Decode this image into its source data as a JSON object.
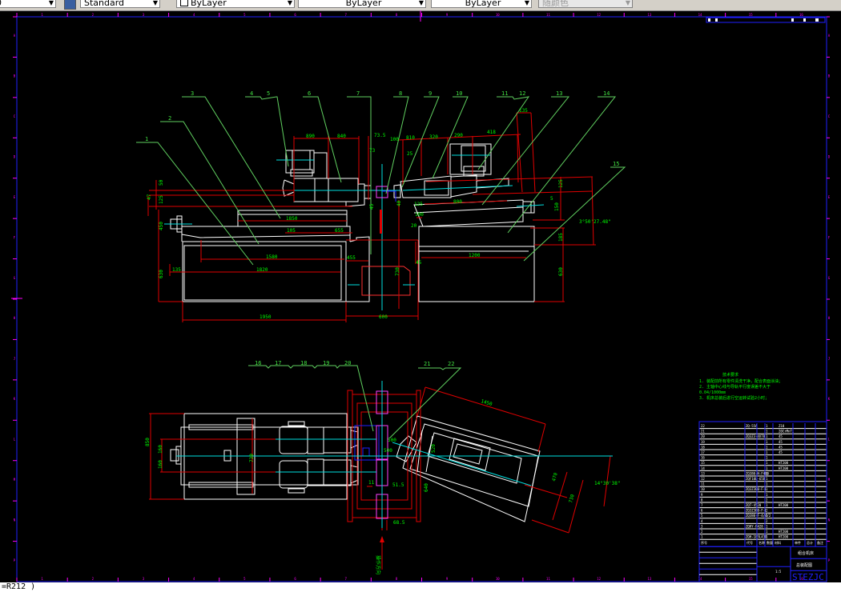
{
  "toolbar": {
    "layer_value": "0",
    "text_style": "Standard",
    "color": "ByLayer",
    "linetype": "ByLayer",
    "lineweight": "ByLayer",
    "plot_style": "随颜色"
  },
  "command_line": "=R212 )",
  "colors": {
    "background": "#000000",
    "frame": "#0000ff",
    "geometry": "#ffffff",
    "dimension": "#ff0000",
    "dim_text": "#00ff00",
    "centerline": "#00ffff",
    "leader": "#80ff80",
    "grid_ref": "#ff00ff"
  },
  "grid_refs": {
    "columns": [
      "1",
      "2",
      "3",
      "4",
      "5",
      "6",
      "7",
      "8",
      "9",
      "10",
      "11",
      "12",
      "13",
      "14",
      "15",
      "16"
    ],
    "rows": [
      "A",
      "B",
      "C",
      "D",
      "E",
      "F",
      "G",
      "H",
      "J",
      "K",
      "L",
      "M",
      "N",
      "P"
    ]
  },
  "balloons": [
    "1",
    "2",
    "3",
    "4",
    "5",
    "6",
    "7",
    "8",
    "9",
    "10",
    "11",
    "12",
    "13",
    "14",
    "15",
    "16",
    "17",
    "18",
    "19",
    "20",
    "21",
    "22"
  ],
  "dims": {
    "front": [
      "890",
      "840",
      "73.5",
      "73",
      "100",
      "810",
      "320",
      "290",
      "418",
      "135",
      "1850",
      "105",
      "655",
      "1580",
      "1820",
      "1950",
      "135",
      "50",
      "47",
      "125",
      "450",
      "630",
      "455",
      "45",
      "25",
      "800",
      "125",
      "100",
      "20",
      "5",
      "125",
      "3°50'27.48\"",
      "185",
      "1200",
      "630",
      "45",
      "600",
      "730",
      "150",
      "40"
    ],
    "plan": [
      "1450",
      "850",
      "160",
      "160",
      "730",
      "14°30'38\"",
      "470",
      "730",
      "500",
      "520",
      "640",
      "51.5",
      "68.5",
      "11",
      "500"
    ]
  },
  "notes": {
    "title": "技术要求",
    "lines": [
      "1. 装配前所有零件清洗干净，配合表面涂油；",
      "2. 主轴中心线与导轨平行度误差不大于",
      "   0.04/1000mm",
      "3. 机床总装后进行空运转试验2小时；"
    ]
  },
  "title_block": {
    "rows": [
      [
        "22",
        "ZQ-55A",
        "1",
        "",
        "Z18"
      ],
      [
        "21",
        "",
        "1",
        "",
        "20CrMnTi"
      ],
      [
        "20",
        "ZQ3Z3-4X78",
        "1",
        "",
        "45"
      ],
      [
        "19",
        "",
        "1",
        "",
        "45"
      ],
      [
        "18",
        "",
        "1",
        "",
        "45"
      ],
      [
        "17",
        "",
        "1",
        "",
        "45"
      ],
      [
        "16",
        "",
        "1",
        "",
        ""
      ],
      [
        "15",
        "",
        "1",
        "",
        "HT200"
      ],
      [
        "14",
        "",
        "1",
        "",
        "HT200"
      ],
      [
        "13",
        "ZQ380-H-F400",
        "1",
        "",
        ""
      ],
      [
        "12",
        "ZQF10L-65B",
        "1",
        "",
        ""
      ],
      [
        "11",
        "",
        "1",
        "",
        ""
      ],
      [
        "10",
        "ZQ3Z380-F-L",
        "1",
        "",
        ""
      ],
      [
        "9",
        "",
        "1",
        "",
        ""
      ],
      [
        "8",
        "",
        "2",
        "",
        ""
      ],
      [
        "7",
        "ZQT-4520",
        "1",
        "",
        "HT200"
      ],
      [
        "6",
        "ZQ3Z380-F-L",
        "2",
        "",
        ""
      ],
      [
        "5",
        "ZQ380-F-4/4/2",
        "2",
        "",
        ""
      ],
      [
        "4",
        "",
        "2",
        "",
        ""
      ],
      [
        "3",
        "ZQHY-F428",
        "1",
        "",
        ""
      ],
      [
        "2",
        "",
        "1",
        "",
        "HT200"
      ],
      [
        "1",
        "ZQH-185L430",
        "1",
        "",
        "HT200"
      ]
    ],
    "header": [
      "序号",
      "代号",
      "名称",
      "数量",
      "材料",
      "单件",
      "总计",
      "备注"
    ],
    "drawing_name": "组合机床",
    "drawing_subtitle": "总装配图",
    "school": "STEZJC",
    "scale": "1:5"
  },
  "direction_label": "操作方向"
}
